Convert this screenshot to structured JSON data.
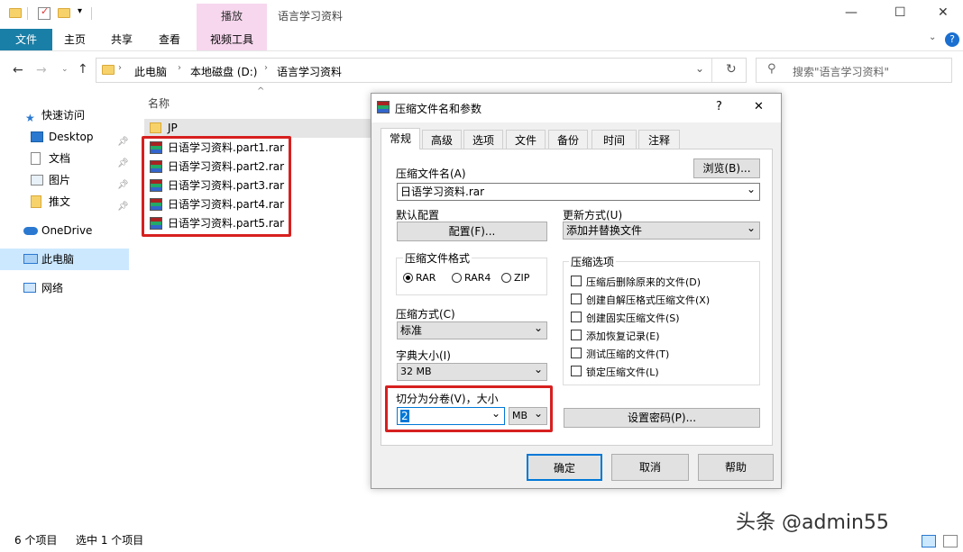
{
  "window": {
    "title": "语言学习资料",
    "context_tab": "播放",
    "minimize": "—",
    "maximize": "☐",
    "close": "✕",
    "help": "?"
  },
  "ribbon": {
    "tabs": [
      "文件",
      "主页",
      "共享",
      "查看",
      "视频工具"
    ]
  },
  "address": {
    "path": [
      "此电脑",
      "本地磁盘 (D:)",
      "语言学习资料"
    ],
    "search_placeholder": "搜索\"语言学习资料\""
  },
  "nav": {
    "items": [
      {
        "label": "快速访问",
        "icon": "star-icon"
      },
      {
        "label": "Desktop",
        "icon": "desktop-icon",
        "pinned": true
      },
      {
        "label": "文档",
        "icon": "document-icon",
        "pinned": true
      },
      {
        "label": "图片",
        "icon": "picture-icon",
        "pinned": true
      },
      {
        "label": "推文",
        "icon": "folder-icon",
        "pinned": true
      },
      {
        "label": "OneDrive",
        "icon": "cloud-icon"
      },
      {
        "label": "此电脑",
        "icon": "pc-icon",
        "selected": true
      },
      {
        "label": "网络",
        "icon": "network-icon"
      }
    ]
  },
  "list": {
    "column_header": "名称",
    "items": [
      "JP",
      "日语学习资料.part1.rar",
      "日语学习资料.part2.rar",
      "日语学习资料.part3.rar",
      "日语学习资料.part4.rar",
      "日语学习资料.part5.rar"
    ]
  },
  "status": {
    "count": "6 个项目",
    "selected": "选中 1 个项目"
  },
  "watermark": "头条 @admin55",
  "dialog": {
    "title": "压缩文件名和参数",
    "tabs": [
      "常规",
      "高级",
      "选项",
      "文件",
      "备份",
      "时间",
      "注释"
    ],
    "archive_name_label": "压缩文件名(A)",
    "archive_name_value": "日语学习资料.rar",
    "browse_button": "浏览(B)...",
    "default_profile_label": "默认配置",
    "profile_button": "配置(F)...",
    "update_mode_label": "更新方式(U)",
    "update_mode_value": "添加并替换文件",
    "format_label": "压缩文件格式",
    "formats": [
      "RAR",
      "RAR4",
      "ZIP"
    ],
    "selected_format": "RAR",
    "method_label": "压缩方式(C)",
    "method_value": "标准",
    "dict_label": "字典大小(I)",
    "dict_value": "32 MB",
    "split_label": "切分为分卷(V)，大小",
    "split_value": "2",
    "split_unit": "MB",
    "options_label": "压缩选项",
    "options": [
      "压缩后删除原来的文件(D)",
      "创建自解压格式压缩文件(X)",
      "创建固实压缩文件(S)",
      "添加恢复记录(E)",
      "测试压缩的文件(T)",
      "锁定压缩文件(L)"
    ],
    "password_button": "设置密码(P)...",
    "ok_button": "确定",
    "cancel_button": "取消",
    "help_button": "帮助"
  },
  "colors": {
    "file_tab": "#1a7fa7",
    "context_tab": "#f7d7ee",
    "highlight_red": "#d6201f",
    "selected_nav": "#cce8ff"
  }
}
